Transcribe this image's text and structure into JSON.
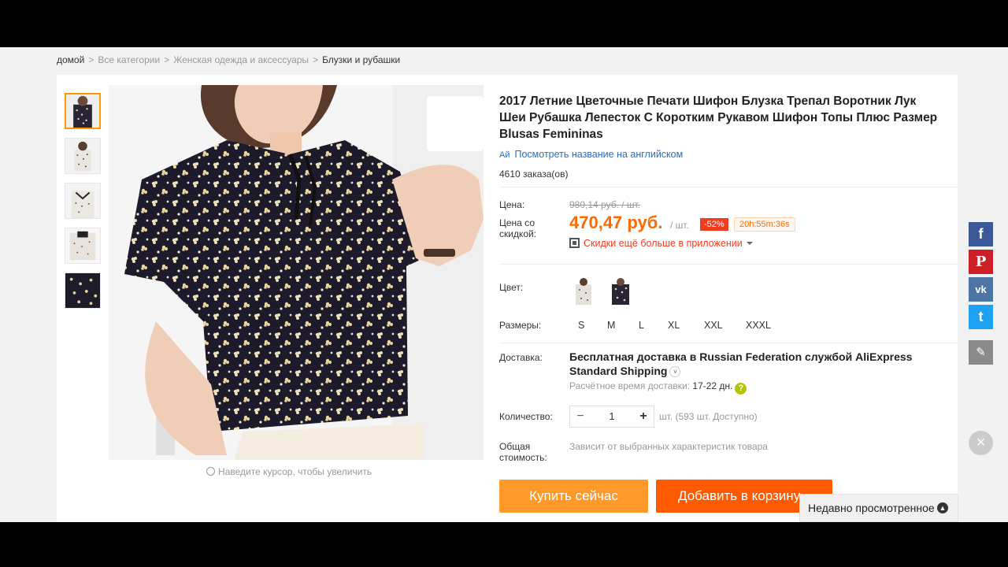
{
  "breadcrumb": {
    "home": "домой",
    "all": "Все категории",
    "cat": "Женская одежда и аксессуары",
    "current": "Блузки и рубашки",
    "sep": ">"
  },
  "product": {
    "title": "2017 Летние Цветочные Печати Шифон Блузка Трепал Воротник Лук Шеи Рубашка Лепесток С Коротким Рукавом Шифон Топы Плюс Размер Blusas Femininas",
    "translate_link": "Посмотреть название на английском",
    "orders": "4610 заказа(ов)",
    "zoom_hint": "Наведите курсор, чтобы увеличить"
  },
  "price": {
    "price_label": "Цена:",
    "old_price": "980,14 руб. / шт.",
    "discount_label": "Цена со скидкой:",
    "new_price": "470,47 руб.",
    "per_unit": "/ шт.",
    "discount": "-52%",
    "timer": "20h:55m:36s",
    "app_discount": "Скидки ещё больше в приложении"
  },
  "color": {
    "label": "Цвет:"
  },
  "sizes": {
    "label": "Размеры:",
    "options": [
      "S",
      "M",
      "L",
      "XL",
      "XXL",
      "XXXL"
    ]
  },
  "shipping": {
    "label": "Доставка:",
    "main": "Бесплатная доставка в Russian Federation службой AliExpress Standard Shipping",
    "time_label": "Расчётное время доставки:",
    "days": "17-22 дн."
  },
  "quantity": {
    "label": "Количество:",
    "value": "1",
    "minus": "−",
    "plus": "+",
    "available": "шт. (593 шт. Доступно)"
  },
  "total": {
    "label": "Общая стоимость:",
    "value": "Зависит от выбранных характеристик товара"
  },
  "buttons": {
    "buy": "Купить сейчас",
    "cart": "Добавить в корзину"
  },
  "social": {
    "facebook": "f",
    "pinterest": "P",
    "vk": "vk",
    "twitter": "t",
    "colors": {
      "facebook": "#3b5998",
      "pinterest": "#cb2027",
      "vk": "#4c75a3",
      "twitter": "#1da1f2",
      "edit": "#8a8a8a"
    }
  },
  "recent": {
    "label": "Недавно просмотренное"
  },
  "theme": {
    "accent": "#ff6a00",
    "link": "#2a6ebb"
  }
}
